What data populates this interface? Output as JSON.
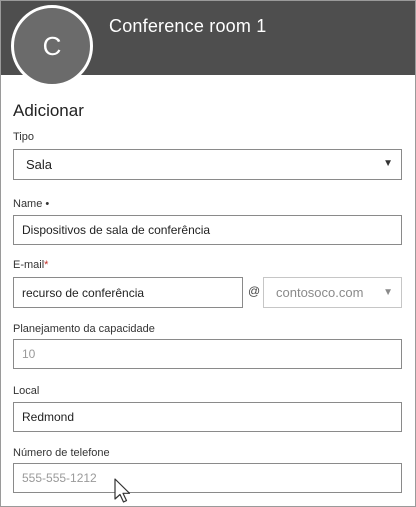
{
  "header": {
    "title": "Conference room 1",
    "avatar_initial": "C"
  },
  "form": {
    "section_title": "Adicionar",
    "type": {
      "label": "Tipo",
      "value": "Sala"
    },
    "name": {
      "label": "Name •",
      "value": "Dispositivos de sala de conferência"
    },
    "email": {
      "label": "E-mail",
      "required_mark": "*",
      "value": "recurso de conferência",
      "at": "@",
      "domain": "contosoco.com"
    },
    "capacity": {
      "label": "Planejamento da capacidade",
      "placeholder": "10"
    },
    "location": {
      "label": "Local",
      "value": "Redmond"
    },
    "phone": {
      "label": "Número de telefone",
      "placeholder": "555-555-1212"
    }
  }
}
